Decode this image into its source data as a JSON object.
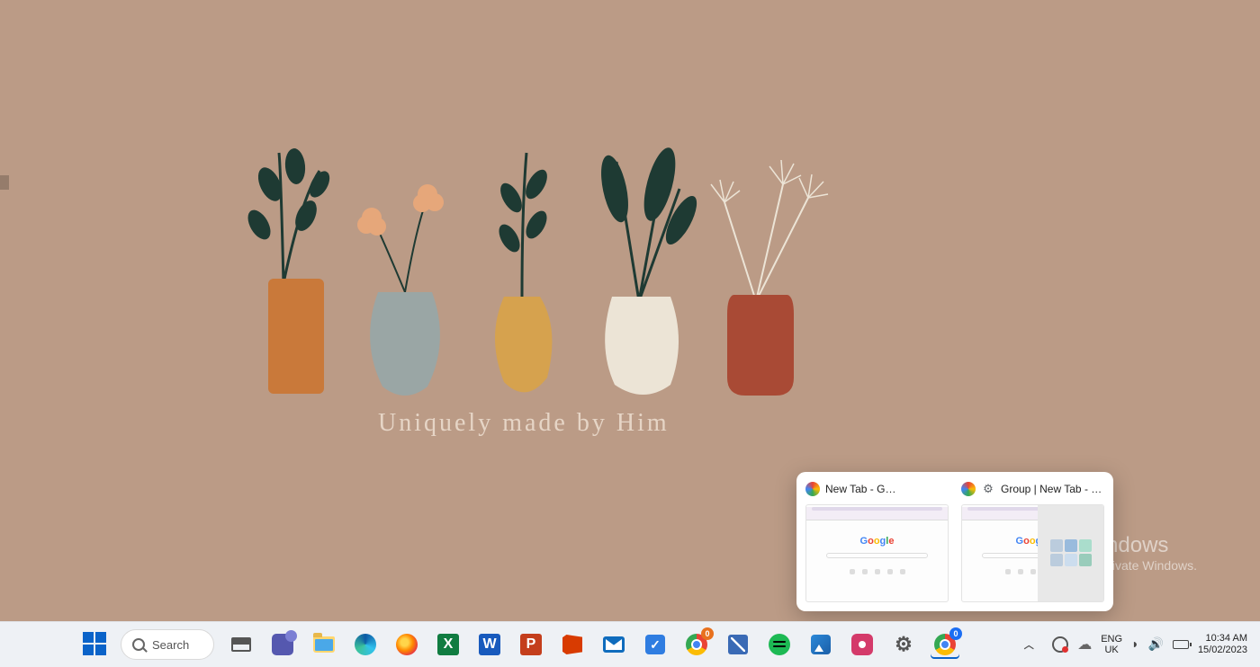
{
  "wallpaper": {
    "caption": "Uniquely made by Him"
  },
  "watermark": {
    "title": "Activate Windows",
    "subtitle": "Go to Settings to activate Windows."
  },
  "thumbnail_popup": {
    "items": [
      {
        "title": "New Tab - G…"
      },
      {
        "title": "Group | New Tab - Google …"
      }
    ]
  },
  "taskbar": {
    "search_label": "Search",
    "apps": [
      {
        "name": "task-view"
      },
      {
        "name": "teams"
      },
      {
        "name": "file-explorer"
      },
      {
        "name": "edge"
      },
      {
        "name": "firefox"
      },
      {
        "name": "excel"
      },
      {
        "name": "word"
      },
      {
        "name": "powerpoint"
      },
      {
        "name": "office"
      },
      {
        "name": "mail"
      },
      {
        "name": "todo"
      },
      {
        "name": "chrome",
        "badge": "0",
        "badge_color": "orange"
      },
      {
        "name": "diagnostics"
      },
      {
        "name": "spotify"
      },
      {
        "name": "photos"
      },
      {
        "name": "recorder"
      },
      {
        "name": "settings"
      },
      {
        "name": "chrome-active",
        "badge": "0",
        "badge_color": "blue"
      }
    ],
    "language": {
      "line1": "ENG",
      "line2": "UK"
    },
    "clock": {
      "time": "10:34 AM",
      "date": "15/02/2023"
    }
  }
}
